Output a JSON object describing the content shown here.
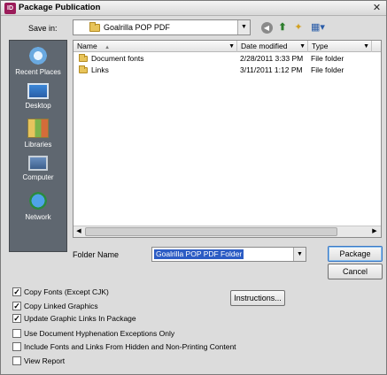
{
  "window": {
    "title": "Package Publication",
    "app_badge": "ID"
  },
  "save_in": {
    "label": "Save in:",
    "value": "Goalrilla POP PDF"
  },
  "places": [
    {
      "label": "Recent Places",
      "icon": "recent-places-icon"
    },
    {
      "label": "Desktop",
      "icon": "desktop-icon"
    },
    {
      "label": "Libraries",
      "icon": "libraries-icon"
    },
    {
      "label": "Computer",
      "icon": "computer-icon"
    },
    {
      "label": "Network",
      "icon": "network-icon"
    }
  ],
  "file_list": {
    "columns": [
      "Name",
      "Date modified",
      "Type"
    ],
    "rows": [
      {
        "name": "Document fonts",
        "date": "2/28/2011 3:33 PM",
        "type": "File folder"
      },
      {
        "name": "Links",
        "date": "3/11/2011 1:12 PM",
        "type": "File folder"
      }
    ]
  },
  "folder_name": {
    "label": "Folder Name",
    "value": "Goalrilla POP PDF Folder"
  },
  "buttons": {
    "package": "Package",
    "cancel": "Cancel",
    "instructions": "Instructions..."
  },
  "options": [
    {
      "label": "Copy Fonts (Except CJK)",
      "checked": true
    },
    {
      "label": "Copy Linked Graphics",
      "checked": true
    },
    {
      "label": "Update Graphic Links In Package",
      "checked": true
    },
    {
      "label": "Use Document Hyphenation Exceptions Only",
      "checked": false
    },
    {
      "label": "Include Fonts and Links From Hidden and Non-Printing Content",
      "checked": false
    },
    {
      "label": "View Report",
      "checked": false
    }
  ],
  "colors": {
    "places_bg": "#5f6770",
    "selection": "#2c5cc4",
    "dialog_bg": "#dcdcdc"
  }
}
